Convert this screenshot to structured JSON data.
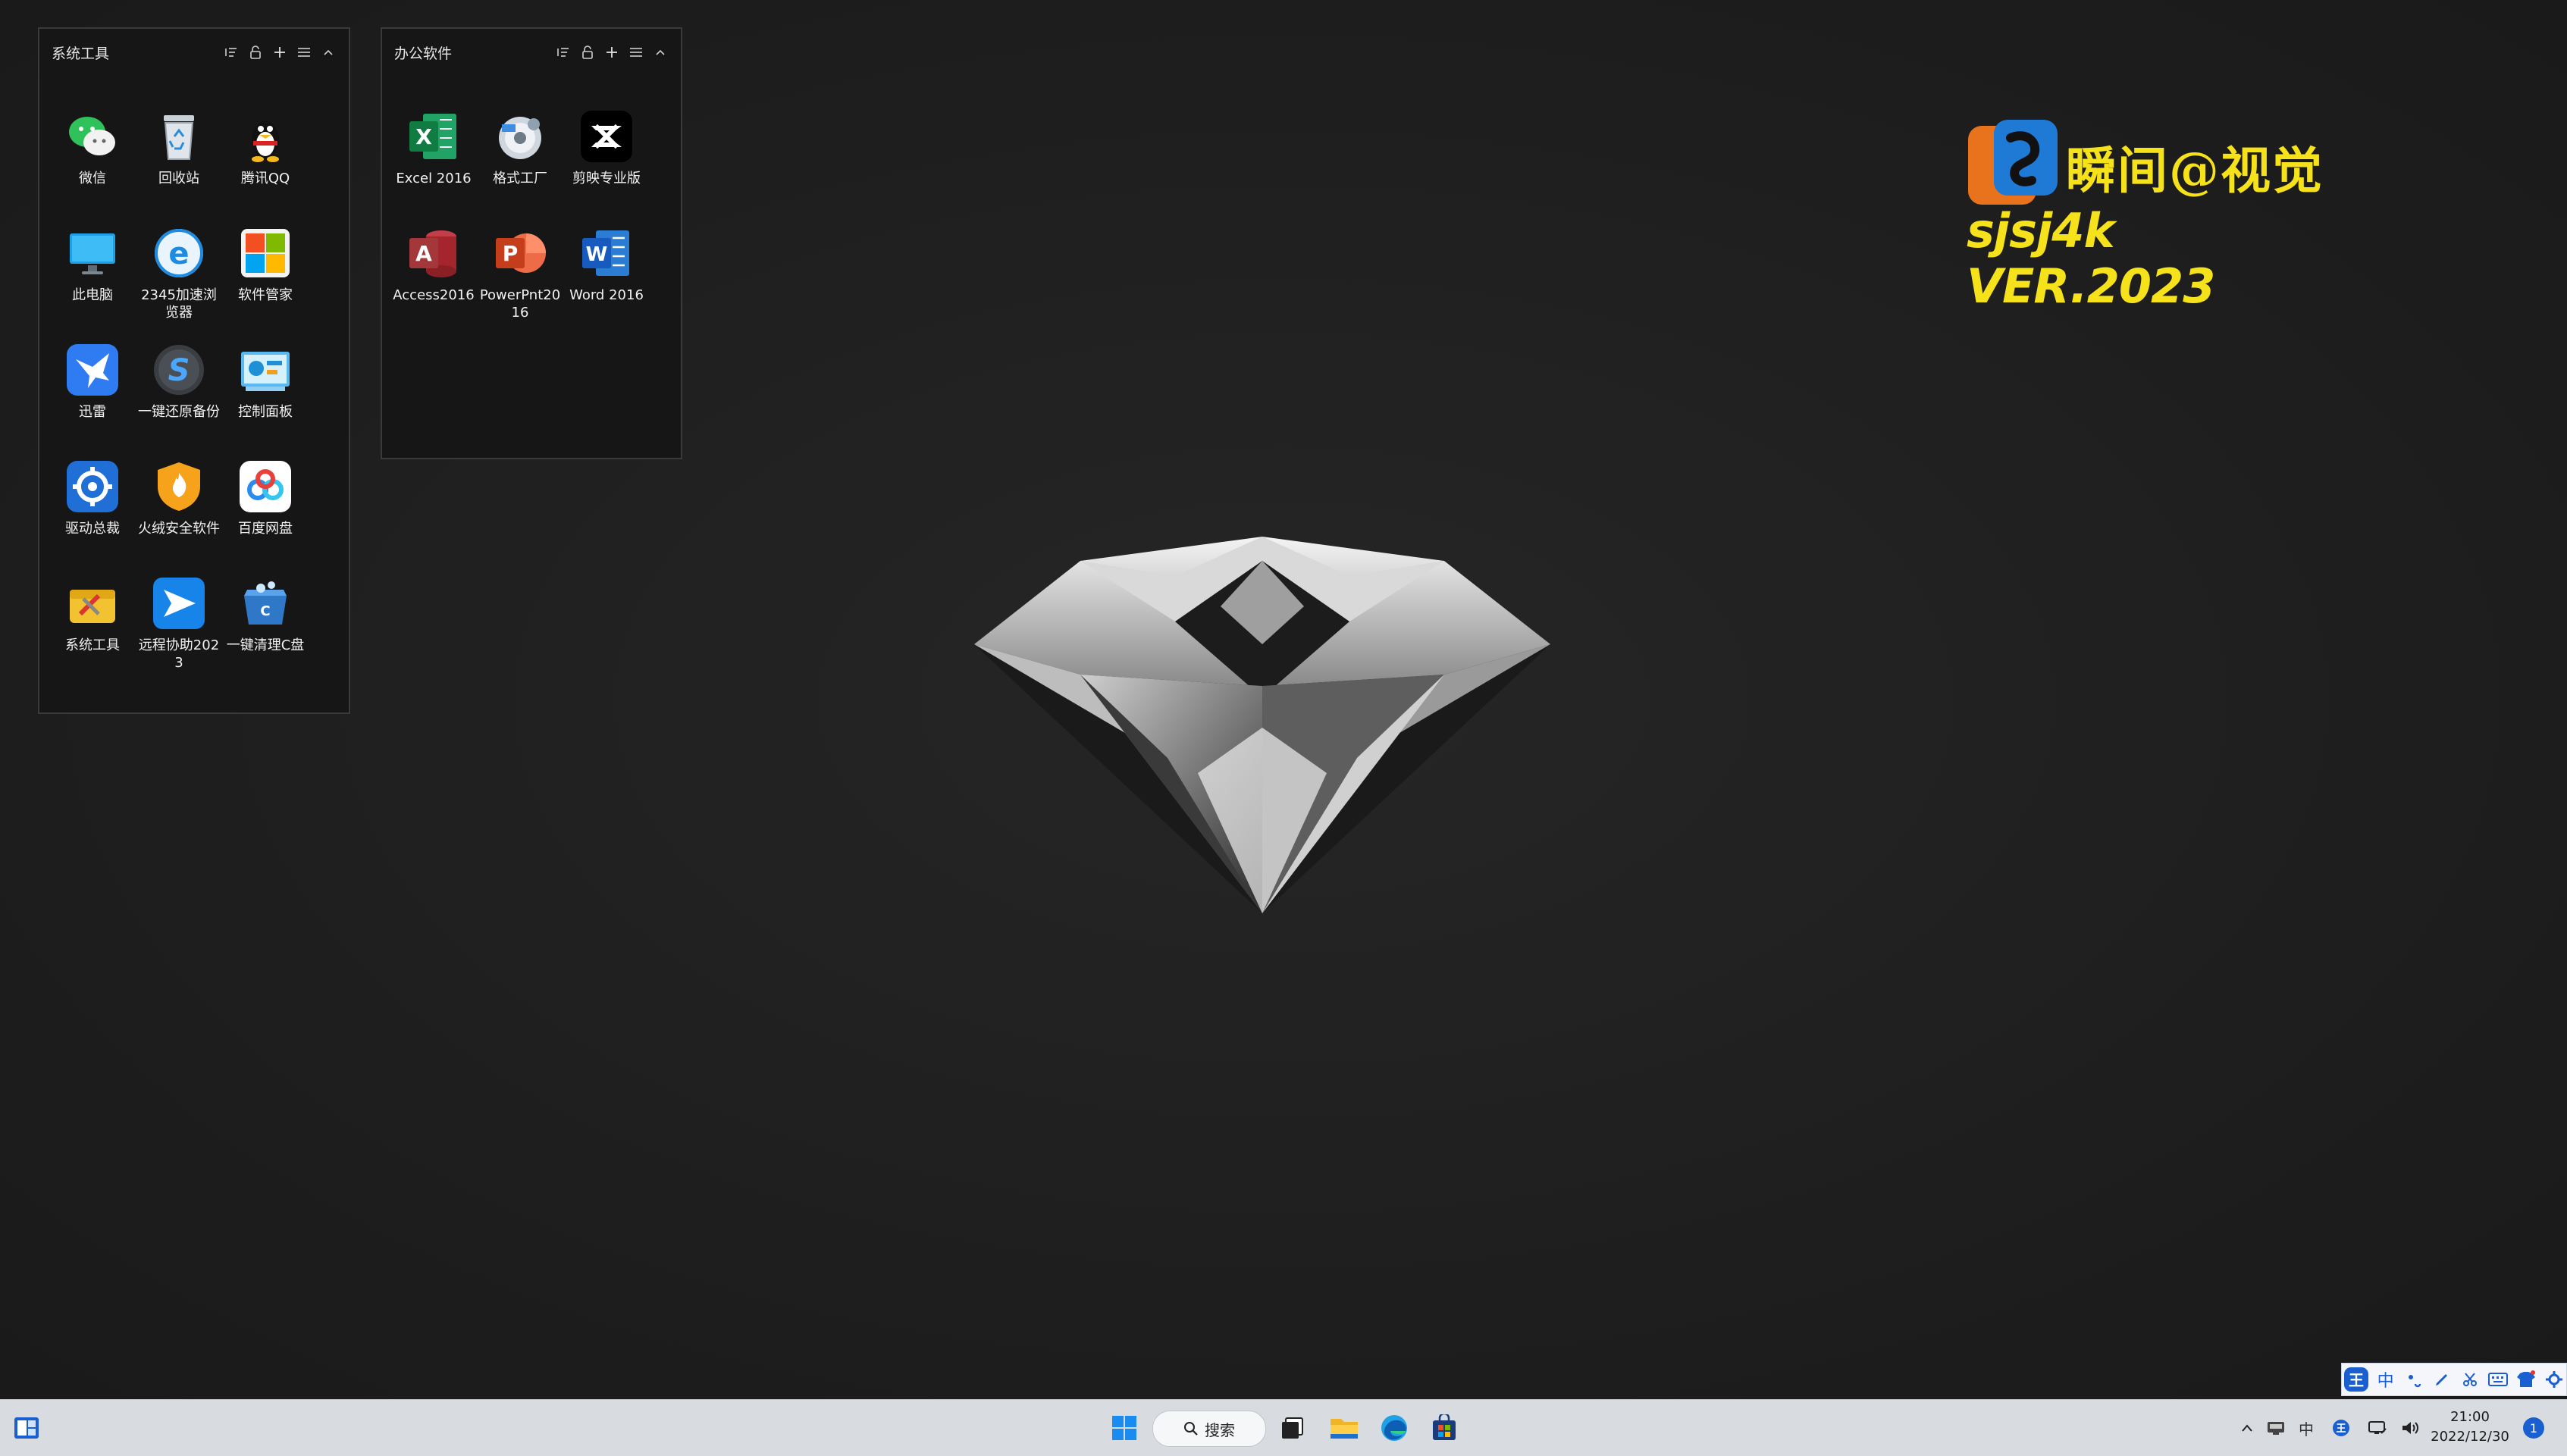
{
  "fences": [
    {
      "title": "系统工具",
      "items": [
        {
          "label": "微信",
          "icon": "wechat-icon"
        },
        {
          "label": "回收站",
          "icon": "recycle-bin-icon"
        },
        {
          "label": "腾讯QQ",
          "icon": "qq-penguin-icon"
        },
        {
          "label": "此电脑",
          "icon": "monitor-icon"
        },
        {
          "label": "2345加速浏览器",
          "icon": "browser-e-icon"
        },
        {
          "label": "软件管家",
          "icon": "windows-squares-icon"
        },
        {
          "label": "迅雷",
          "icon": "thunder-bird-icon"
        },
        {
          "label": "一键还原备份",
          "icon": "restore-s-icon"
        },
        {
          "label": "控制面板",
          "icon": "control-panel-icon"
        },
        {
          "label": "驱动总裁",
          "icon": "driver-gear-icon"
        },
        {
          "label": "火绒安全软件",
          "icon": "shield-flame-icon"
        },
        {
          "label": "百度网盘",
          "icon": "cloud-drive-icon"
        },
        {
          "label": "系统工具",
          "icon": "toolbox-icon"
        },
        {
          "label": "远程协助2023",
          "icon": "remote-arrow-icon"
        },
        {
          "label": "一键清理C盘",
          "icon": "clean-box-icon"
        }
      ]
    },
    {
      "title": "办公软件",
      "items": [
        {
          "label": "Excel 2016",
          "icon": "excel-icon"
        },
        {
          "label": "格式工厂",
          "icon": "format-factory-icon"
        },
        {
          "label": "剪映专业版",
          "icon": "capcut-icon"
        },
        {
          "label": "Access2016",
          "icon": "access-icon"
        },
        {
          "label": "PowerPnt2016",
          "icon": "powerpoint-icon"
        },
        {
          "label": "Word 2016",
          "icon": "word-icon"
        }
      ]
    }
  ],
  "fence_tools": [
    "sort-icon",
    "lock-icon",
    "add-icon",
    "menu-icon",
    "collapse-chevron-icon"
  ],
  "logo": {
    "cn": "瞬间@视觉",
    "en": "sjsj4k VER.2023"
  },
  "taskbar": {
    "search_label": "搜索",
    "time": "21:00",
    "date": "2022/12/30",
    "notification_count": "1"
  },
  "ime": {
    "lang": "中"
  },
  "colors": {
    "accent": "#1a5fd0",
    "logo_yellow": "#f5e21a",
    "desktop_bg": "#1f1f1f",
    "taskbar_bg": "#d8dbe0"
  }
}
